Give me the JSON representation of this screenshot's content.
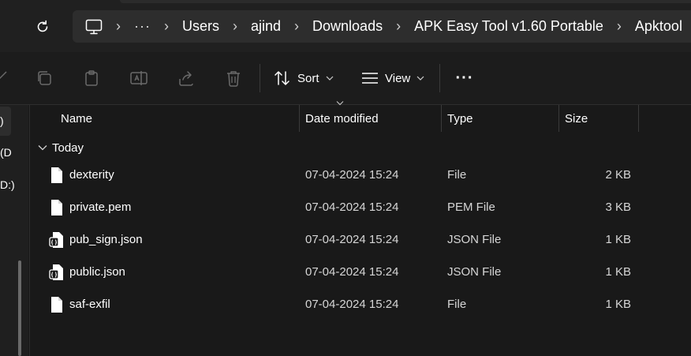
{
  "address_bar": {
    "crumbs": [
      "Users",
      "ajind",
      "Downloads",
      "APK Easy Tool v1.60 Portable",
      "Apktool"
    ],
    "ellipsis": "···",
    "separator": "›"
  },
  "toolbar": {
    "sort_label": "Sort",
    "view_label": "View",
    "more_label": "···"
  },
  "nav_pane": {
    "fragments": [
      ")",
      "(D",
      "D:)"
    ]
  },
  "columns": {
    "name": "Name",
    "date_modified": "Date modified",
    "type": "Type",
    "size": "Size"
  },
  "group": {
    "label": "Today"
  },
  "files": [
    {
      "name": "dexterity",
      "date": "07-04-2024 15:24",
      "type": "File",
      "size": "2 KB",
      "icon": "file-icon"
    },
    {
      "name": "private.pem",
      "date": "07-04-2024 15:24",
      "type": "PEM File",
      "size": "3 KB",
      "icon": "file-icon"
    },
    {
      "name": "pub_sign.json",
      "date": "07-04-2024 15:24",
      "type": "JSON File",
      "size": "1 KB",
      "icon": "json-file-icon"
    },
    {
      "name": "public.json",
      "date": "07-04-2024 15:24",
      "type": "JSON File",
      "size": "1 KB",
      "icon": "json-file-icon"
    },
    {
      "name": "saf-exfil",
      "date": "07-04-2024 15:24",
      "type": "File",
      "size": "1 KB",
      "icon": "file-icon"
    }
  ],
  "colors": {
    "background": "#191919",
    "address_bar": "#2d2d2d",
    "toolbar": "#1c1c1c",
    "text": "#ffffff"
  }
}
